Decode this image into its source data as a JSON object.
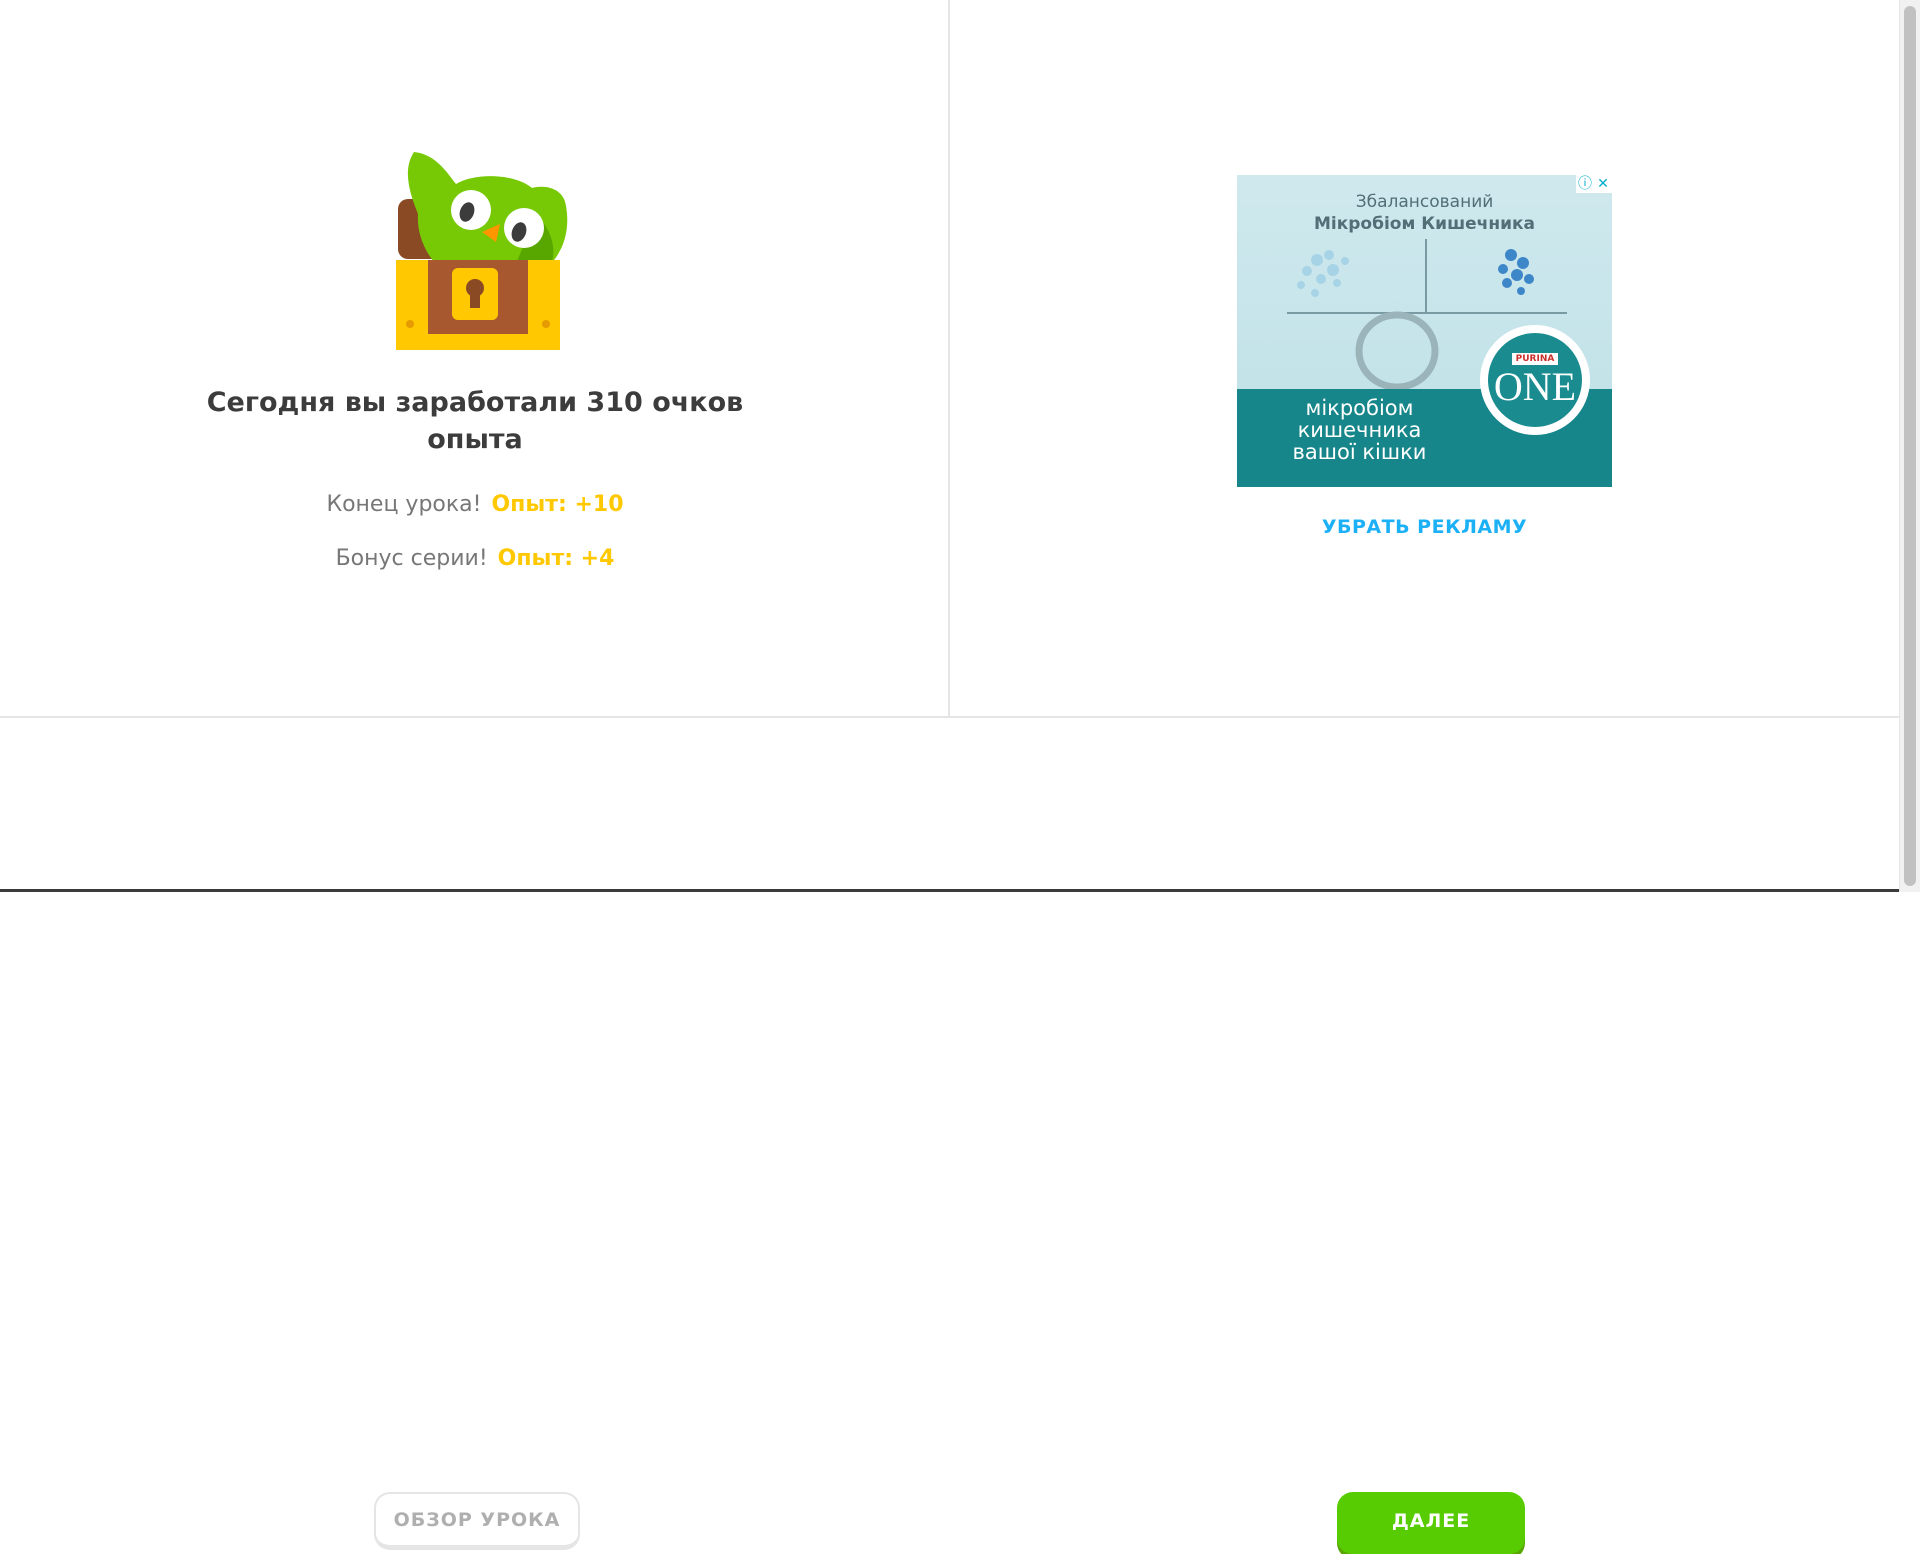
{
  "summary": {
    "headline": "Сегодня вы заработали 310 очков опыта",
    "rows": [
      {
        "label": "Конец урока!",
        "value": "Опыт: +10"
      },
      {
        "label": "Бонус серии!",
        "value": "Опыт: +4"
      }
    ]
  },
  "ad": {
    "title_line1": "Збалансований",
    "title_line2": "Мікробіом Кишечника",
    "cta_line1": "мікробіом",
    "cta_line2": "кишечника",
    "cta_line3": "вашої кішки",
    "brand": "PURINA",
    "product": "ONE",
    "remove_label": "УБРАТЬ РЕКЛАМУ"
  },
  "footer": {
    "review_label": "ОБЗОР УРОКА",
    "next_label": "ДАЛЕЕ"
  },
  "colors": {
    "xp_gold": "#ffc800",
    "green": "#58cc02",
    "blue_link": "#1cb0f6"
  }
}
